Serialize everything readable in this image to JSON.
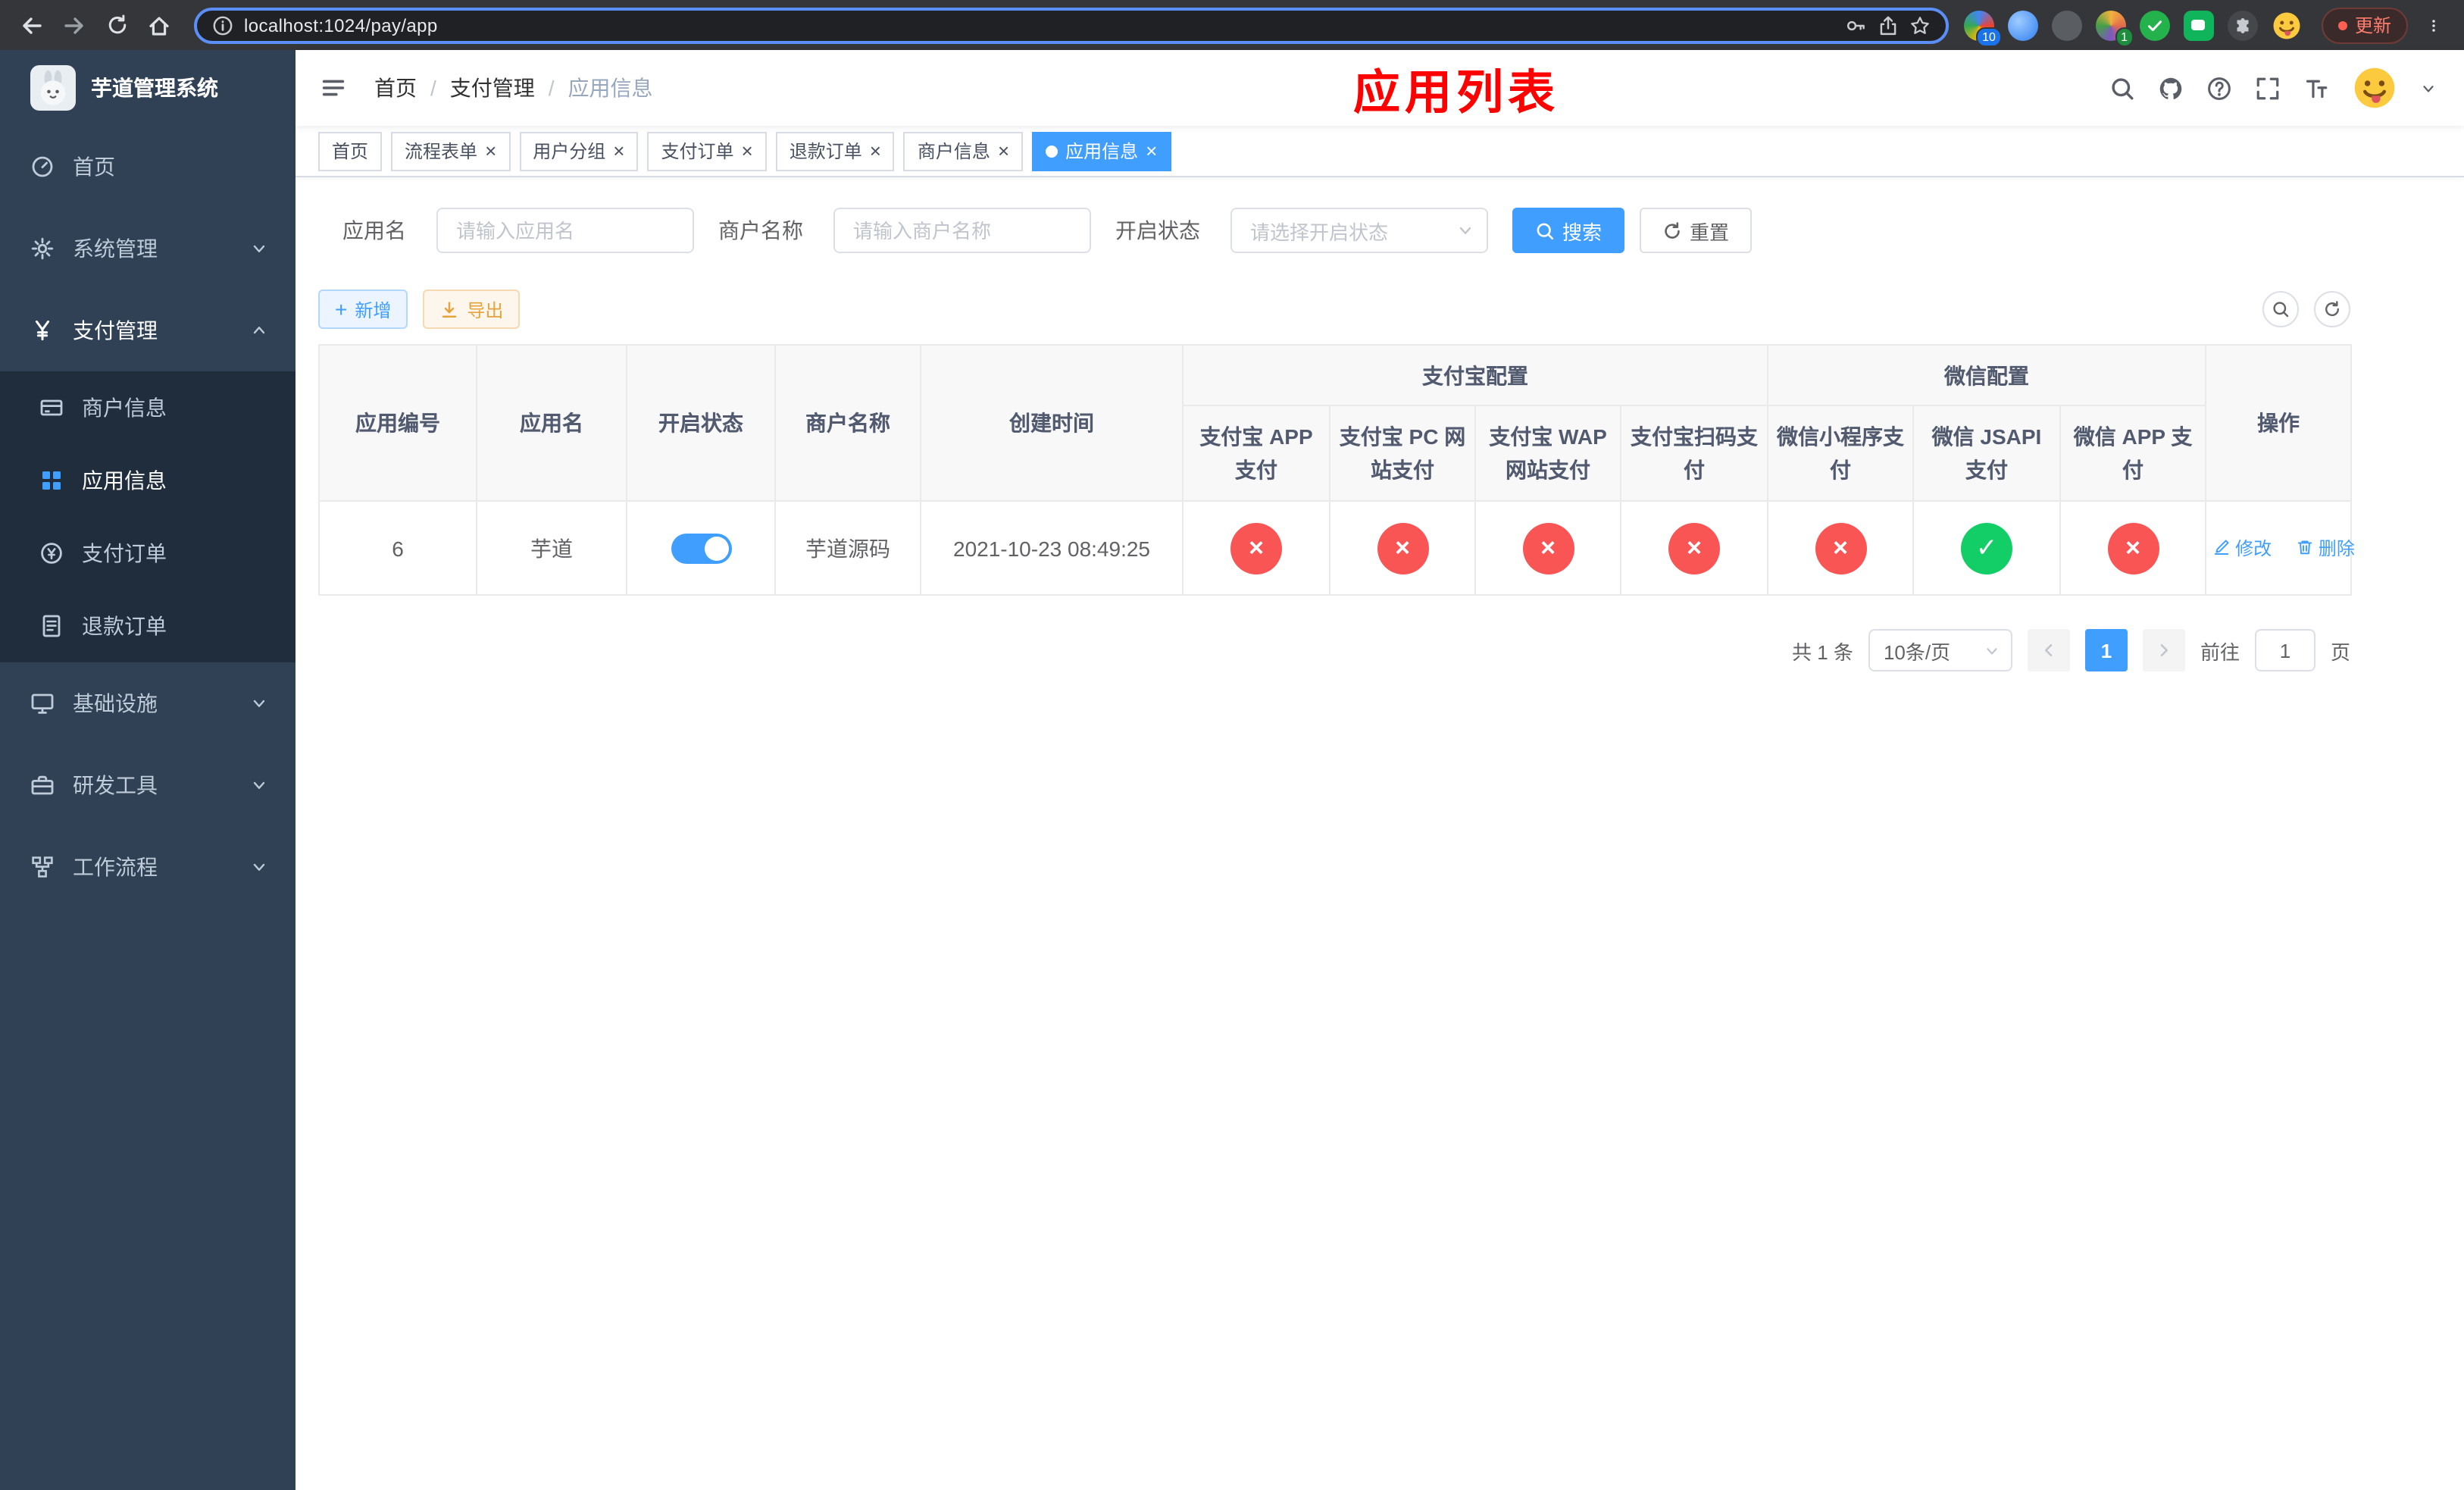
{
  "colors": {
    "primary": "#409eff",
    "danger": "#fa5555",
    "success": "#13ce66",
    "warning": "#e6a23c",
    "annotation": "#ff0000",
    "sidebar_bg": "#304156",
    "submenu_bg": "#1f2d3d"
  },
  "icons": {
    "check": "✓",
    "cross": "×",
    "close": "×",
    "plus": "+"
  },
  "browser": {
    "url": "localhost:1024/pay/app",
    "update_button": "更新",
    "extensions_badge": "10",
    "profile_badge": "1"
  },
  "sidebar": {
    "title": "芋道管理系统",
    "items": [
      {
        "label": "首页"
      },
      {
        "label": "系统管理"
      },
      {
        "label": "支付管理",
        "children": [
          {
            "label": "商户信息"
          },
          {
            "label": "应用信息"
          },
          {
            "label": "支付订单"
          },
          {
            "label": "退款订单"
          }
        ]
      },
      {
        "label": "基础设施"
      },
      {
        "label": "研发工具"
      },
      {
        "label": "工作流程"
      }
    ]
  },
  "navbar": {
    "breadcrumb": [
      "首页",
      "支付管理",
      "应用信息"
    ],
    "annotation": "应用列表"
  },
  "tabs": [
    {
      "label": "首页"
    },
    {
      "label": "流程表单"
    },
    {
      "label": "用户分组"
    },
    {
      "label": "支付订单"
    },
    {
      "label": "退款订单"
    },
    {
      "label": "商户信息"
    },
    {
      "label": "应用信息"
    }
  ],
  "filters": {
    "app_name": {
      "label": "应用名",
      "placeholder": "请输入应用名",
      "value": ""
    },
    "merchant_name": {
      "label": "商户名称",
      "placeholder": "请输入商户名称",
      "value": ""
    },
    "status": {
      "label": "开启状态",
      "placeholder": "请选择开启状态"
    },
    "search_button": "搜索",
    "reset_button": "重置"
  },
  "toolbar": {
    "add_button": "新增",
    "export_button": "导出"
  },
  "table": {
    "columns": [
      "应用编号",
      "应用名",
      "开启状态",
      "商户名称",
      "创建时间"
    ],
    "group_alipay": "支付宝配置",
    "group_wechat": "微信配置",
    "alipay_columns": [
      "支付宝 APP 支付",
      "支付宝 PC 网站支付",
      "支付宝 WAP 网站支付",
      "支付宝扫码支付"
    ],
    "wechat_columns": [
      "微信小程序支付",
      "微信 JSAPI 支付",
      "微信 APP 支付"
    ],
    "actions_column": "操作",
    "rows": [
      {
        "id": "6",
        "name": "芋道",
        "enabled": true,
        "merchant": "芋道源码",
        "created_at": "2021-10-23 08:49:25",
        "configs": {
          "alipay_app": false,
          "alipay_pc": false,
          "alipay_wap": false,
          "alipay_qr": false,
          "wechat_mini": false,
          "wechat_jsapi": true,
          "wechat_app": false
        },
        "edit_action": "修改",
        "delete_action": "删除"
      }
    ]
  },
  "pagination": {
    "total": "共 1 条",
    "page_size": "10条/页",
    "current_page": "1",
    "goto_label": "前往",
    "goto_value": "1",
    "goto_unit": "页"
  }
}
